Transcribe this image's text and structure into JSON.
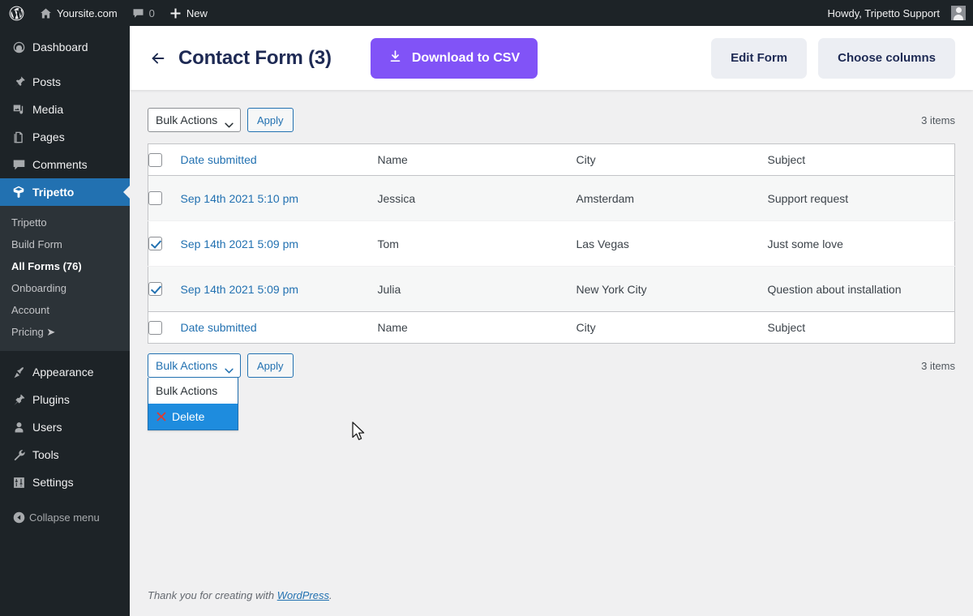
{
  "adminbar": {
    "logo_icon": "wordpress-logo-icon",
    "site": {
      "icon": "home-icon",
      "label": "Yoursite.com"
    },
    "comments": {
      "icon": "comment-bubble-icon",
      "count": "0"
    },
    "new": {
      "icon": "plus-icon",
      "label": "New"
    },
    "account": {
      "greeting": "Howdy, Tripetto Support",
      "avatar": "user-avatar"
    }
  },
  "sidebar": {
    "items": [
      {
        "label": "Dashboard",
        "icon": "dashboard-icon"
      },
      {
        "label": "Posts",
        "icon": "pin-icon"
      },
      {
        "label": "Media",
        "icon": "media-icon"
      },
      {
        "label": "Pages",
        "icon": "pages-icon"
      },
      {
        "label": "Comments",
        "icon": "comment-bubble-icon"
      },
      {
        "label": "Tripetto",
        "icon": "tripetto-logo-icon",
        "current": true
      }
    ],
    "submenu": [
      {
        "label": "Tripetto"
      },
      {
        "label": "Build Form"
      },
      {
        "label": "All Forms (76)",
        "current": true
      },
      {
        "label": "Onboarding"
      },
      {
        "label": "Account"
      },
      {
        "label": "Pricing ➤"
      }
    ],
    "items_lower": [
      {
        "label": "Appearance",
        "icon": "paintbrush-icon"
      },
      {
        "label": "Plugins",
        "icon": "plug-icon"
      },
      {
        "label": "Users",
        "icon": "user-icon"
      },
      {
        "label": "Tools",
        "icon": "wrench-icon"
      },
      {
        "label": "Settings",
        "icon": "sliders-icon"
      }
    ],
    "collapse": {
      "label": "Collapse menu",
      "icon": "collapse-arrow-icon"
    }
  },
  "header": {
    "back_icon": "back-arrow-icon",
    "title": "Contact Form (3)",
    "download_button": {
      "label": "Download to CSV",
      "icon": "download-icon"
    },
    "edit_form_button": "Edit Form",
    "choose_columns_button": "Choose columns"
  },
  "toolbar_top": {
    "bulk_actions_label": "Bulk Actions",
    "apply_label": "Apply",
    "items_count": "3 items"
  },
  "toolbar_bottom": {
    "bulk_actions_label": "Bulk Actions",
    "apply_label": "Apply",
    "items_count": "3 items"
  },
  "dropdown": {
    "open": true,
    "options": [
      {
        "label": "Bulk Actions",
        "selected": false,
        "icon": ""
      },
      {
        "label": "Delete",
        "selected": true,
        "icon": "red-x-icon"
      }
    ]
  },
  "table": {
    "columns": [
      "Date submitted",
      "Name",
      "City",
      "Subject"
    ],
    "rows": [
      {
        "checked": false,
        "date": "Sep 14th 2021 5:10 pm",
        "name": "Jessica",
        "city": "Amsterdam",
        "subject": "Support request"
      },
      {
        "checked": true,
        "date": "Sep 14th 2021 5:09 pm",
        "name": "Tom",
        "city": "Las Vegas",
        "subject": "Just some love"
      },
      {
        "checked": true,
        "date": "Sep 14th 2021 5:09 pm",
        "name": "Julia",
        "city": "New York City",
        "subject": "Question about installation"
      }
    ]
  },
  "footer": {
    "text_before": "Thank you for creating with ",
    "link": "WordPress",
    "text_after": "."
  },
  "colors": {
    "admin_dark": "#1d2327",
    "admin_submenu": "#2c3338",
    "wp_blue": "#2271b1",
    "purple": "#8153f7",
    "title_navy": "#1e2a54",
    "page_bg": "#f0f0f1",
    "row_alt": "#f6f7f7",
    "highlight": "#1e8cde"
  }
}
